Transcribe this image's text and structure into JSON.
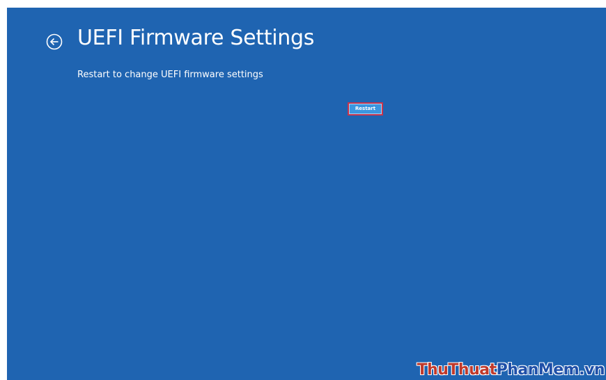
{
  "header": {
    "title": "UEFI Firmware Settings",
    "back_icon": "arrow-left-circle-icon"
  },
  "main": {
    "description": "Restart to change UEFI firmware settings",
    "restart_label": "Restart"
  },
  "watermark": {
    "part1": "ThuThuat",
    "part2": "PhanMem",
    "part3": ".vn"
  },
  "colors": {
    "background": "#1f64b1",
    "button": "#3b96e0",
    "button_highlight": "#c8344c",
    "text": "#ffffff"
  }
}
